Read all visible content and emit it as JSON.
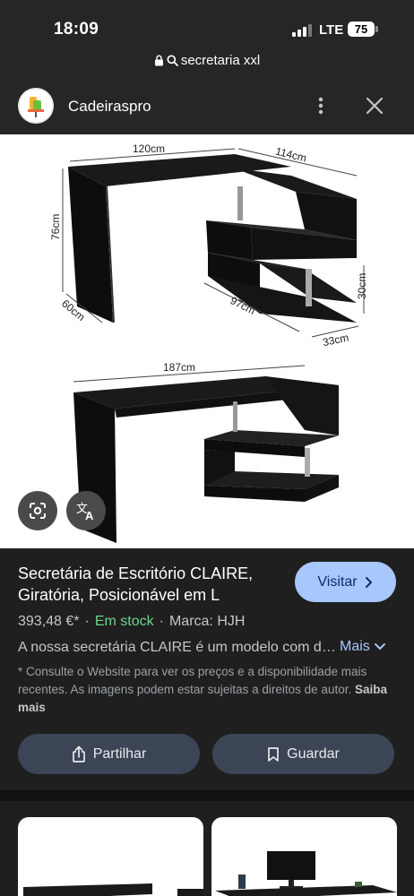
{
  "status_bar": {
    "time": "18:09",
    "network": "LTE",
    "battery": "75"
  },
  "url_bar": {
    "query": "secretaria xxl"
  },
  "site_header": {
    "name": "Cadeiraspro"
  },
  "image": {
    "dimensions": {
      "width_top": "120cm",
      "depth_side": "114cm",
      "height": "76cm",
      "depth": "60cm",
      "bottom_width": "97cm",
      "shelf_height": "30cm",
      "shelf_depth": "33cm",
      "full_width": "187cm"
    }
  },
  "product": {
    "title": "Secretária de Escritório CLAIRE, Giratória, Posicionável em L",
    "price": "393,48 €*",
    "stock": "Em stock",
    "brand": "Marca: HJH",
    "description": "A nossa secretária CLAIRE é um modelo com design moderno",
    "disclaimer": "* Consulte o Website para ver os preços e a disponibilidade mais recentes. As imagens podem estar sujeitas a direitos de autor.",
    "learn_more": "Saiba mais"
  },
  "buttons": {
    "visit": "Visitar",
    "more": "Mais",
    "share": "Partilhar",
    "save": "Guardar"
  },
  "colors": {
    "accent": "#a8c7fa",
    "stock_green": "#6dd58c",
    "panel_bg": "#1f1f1f",
    "button_bg": "#3c4556"
  }
}
